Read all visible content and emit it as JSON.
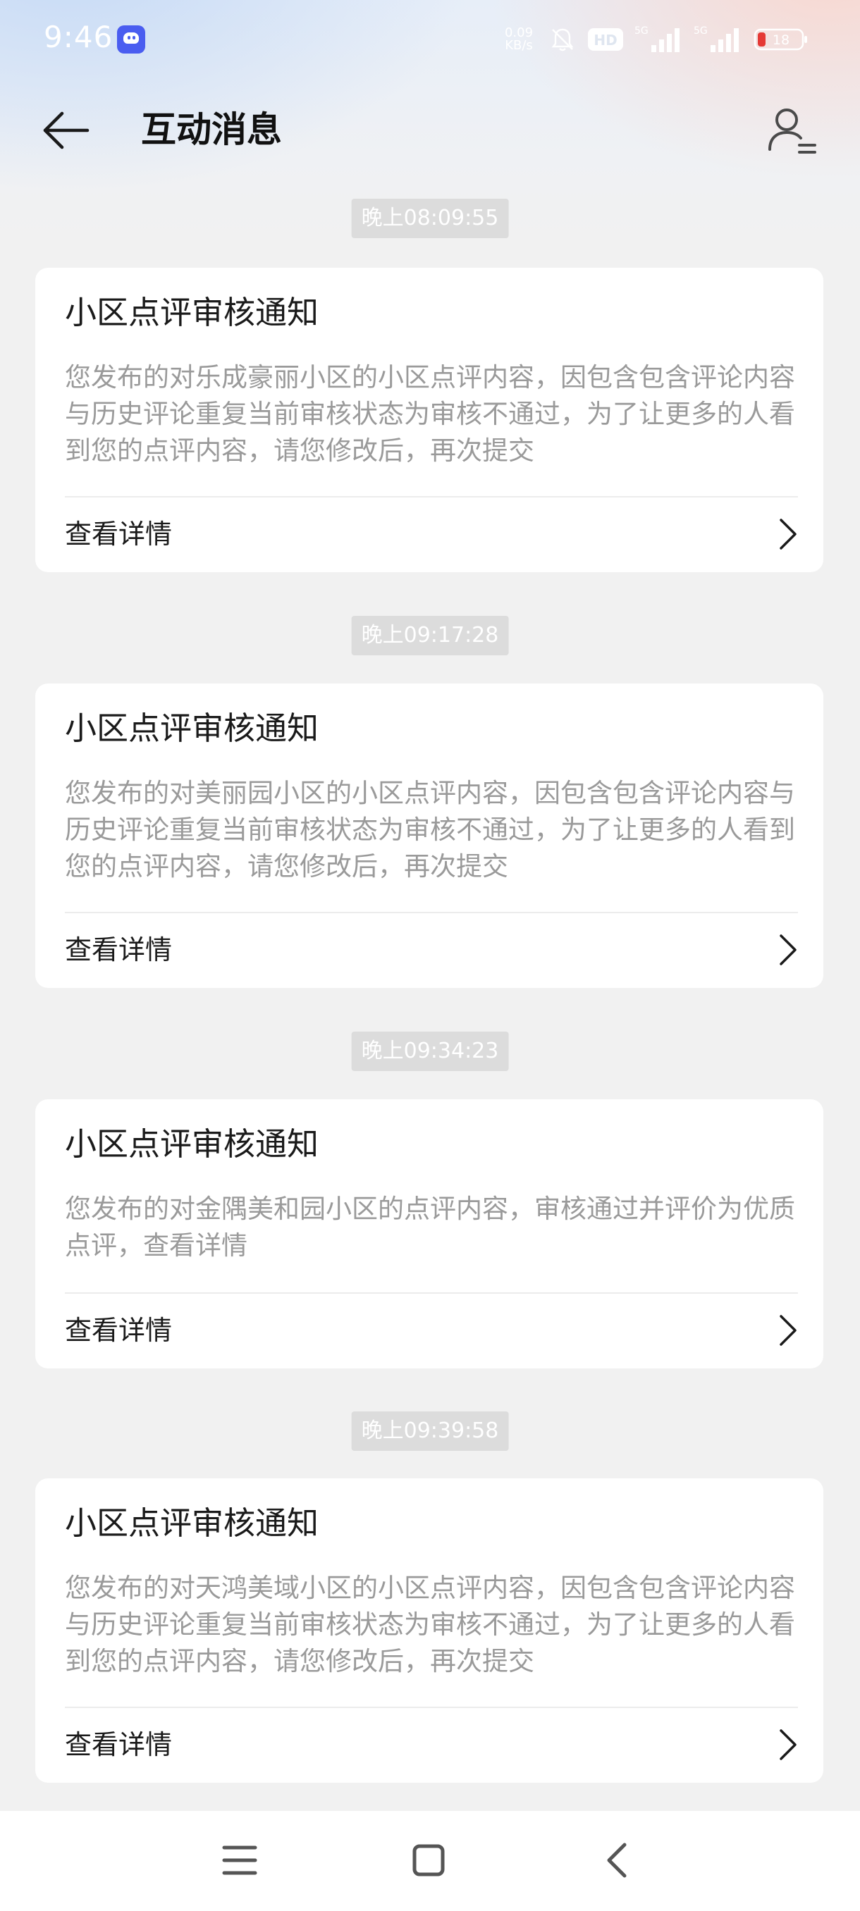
{
  "status_bar": {
    "time": "9:46",
    "net_speed_value": "0.09",
    "net_speed_unit": "KB/s",
    "hd_label": "HD",
    "signal1_label": "5G",
    "signal2_label": "5G",
    "battery_level": "18",
    "battery_percent": 18,
    "battery_color": "#e53935"
  },
  "header": {
    "title": "互动消息",
    "back_icon": "arrow-left-icon",
    "profile_icon": "user-list-icon"
  },
  "messages": [
    {
      "timestamp": "晚上08:09:55",
      "title": "小区点评审核通知",
      "body": "您发布的对乐成豪丽小区的小区点评内容，因包含包含评论内容与历史评论重复当前审核状态为审核不通过，为了让更多的人看到您的点评内容，请您修改后，再次提交",
      "action": "查看详情"
    },
    {
      "timestamp": "晚上09:17:28",
      "title": "小区点评审核通知",
      "body": "您发布的对美丽园小区的小区点评内容，因包含包含评论内容与历史评论重复当前审核状态为审核不通过，为了让更多的人看到您的点评内容，请您修改后，再次提交",
      "action": "查看详情"
    },
    {
      "timestamp": "晚上09:34:23",
      "title": "小区点评审核通知",
      "body": "您发布的对金隅美和园小区的点评内容，审核通过并评价为优质点评，查看详情",
      "action": "查看详情"
    },
    {
      "timestamp": "晚上09:39:58",
      "title": "小区点评审核通知",
      "body": "您发布的对天鸿美域小区的小区点评内容，因包含包含评论内容与历史评论重复当前审核状态为审核不通过，为了让更多的人看到您的点评内容，请您修改后，再次提交",
      "action": "查看详情"
    }
  ],
  "nav_bar": {
    "menu_icon": "menu-icon",
    "home_icon": "home-icon",
    "back_icon": "back-chevron-icon"
  }
}
